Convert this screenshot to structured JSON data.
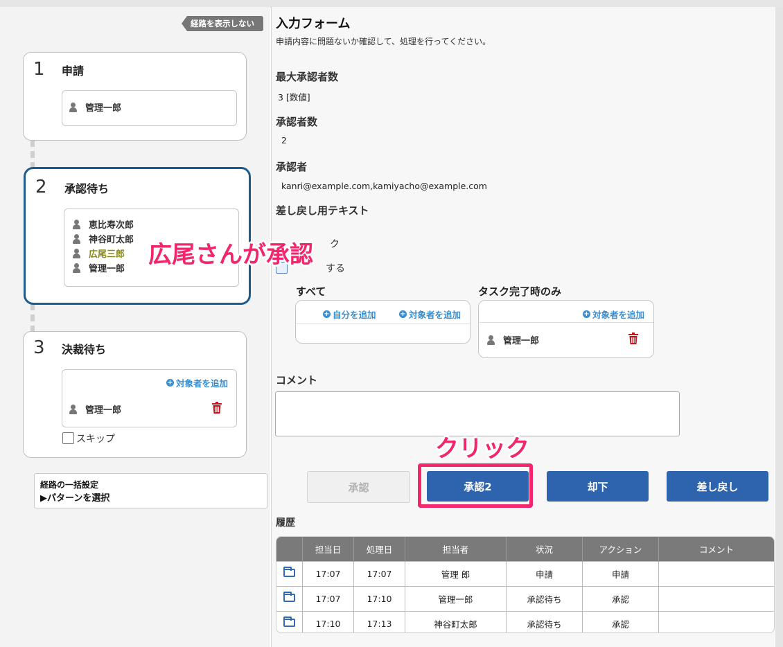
{
  "left": {
    "toggle_route_label": "経路を表示しない",
    "steps": [
      {
        "num": "1",
        "title": "申請",
        "people": [
          "管理一郎"
        ]
      },
      {
        "num": "2",
        "title": "承認待ち",
        "people": [
          "恵比寿次郎",
          "神谷町太郎",
          "広尾三郎",
          "管理一郎"
        ]
      },
      {
        "num": "3",
        "title": "決裁待ち",
        "add_label": "対象者を追加",
        "people": [
          "管理一郎"
        ],
        "skip_label": "スキップ"
      }
    ],
    "pattern": {
      "line1": "経路の一括設定",
      "line2": "▶パターンを選択"
    }
  },
  "form": {
    "title": "入力フォーム",
    "description": "申請内容に問題ないか確認して、処理を行ってください。",
    "max_approvers_label": "最大承認者数",
    "max_approvers_value": "3 [数値]",
    "approver_count_label": "承認者数",
    "approver_count_value": "2",
    "approvers_label": "承認者",
    "approvers_value": "kanri@example.com,kamiyacho@example.com",
    "sendback_text_label": "差し戻し用テキスト",
    "hidden_label_1": "ク",
    "hidden_label_2": "する",
    "all_label": "すべて",
    "add_self_label": "自分を追加",
    "add_target_label": "対象者を追加",
    "task_done_label": "タスク完了時のみ",
    "task_done_add_label": "対象者を追加",
    "task_done_person": "管理一郎",
    "comment_label": "コメント"
  },
  "buttons": {
    "approve": "承認",
    "approve2": "承認2",
    "reject": "却下",
    "sendback": "差し戻し"
  },
  "history": {
    "label": "履歴",
    "headers": [
      "",
      "担当日",
      "処理日",
      "担当者",
      "状況",
      "アクション",
      "コメント"
    ],
    "rows": [
      {
        "assigned": "17:07",
        "processed": "17:07",
        "person": "管理 郎",
        "status": "申請",
        "action": "申請",
        "comment": ""
      },
      {
        "assigned": "17:07",
        "processed": "17:10",
        "person": "管理一郎",
        "status": "承認待ち",
        "action": "承認",
        "comment": ""
      },
      {
        "assigned": "17:10",
        "processed": "17:13",
        "person": "神谷町太郎",
        "status": "承認待ち",
        "action": "承認",
        "comment": ""
      }
    ]
  },
  "annotations": {
    "approval_note": "広尾さんが承認",
    "click_note": "クリック"
  },
  "colors": {
    "accent": "#2e63ae",
    "highlight": "#f2266c",
    "link": "#3a8ed0",
    "trash": "#c0161c",
    "current_step_border": "#1d5b8c",
    "highlighted_person": "#8a8a1a"
  }
}
